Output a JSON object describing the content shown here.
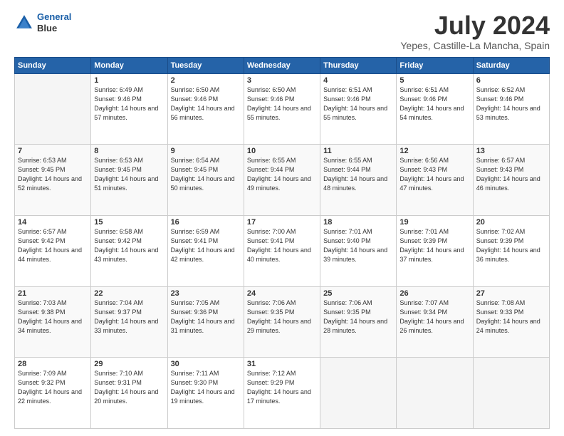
{
  "logo": {
    "line1": "General",
    "line2": "Blue"
  },
  "title": "July 2024",
  "subtitle": "Yepes, Castille-La Mancha, Spain",
  "days_header": [
    "Sunday",
    "Monday",
    "Tuesday",
    "Wednesday",
    "Thursday",
    "Friday",
    "Saturday"
  ],
  "weeks": [
    [
      {
        "day": "",
        "sunrise": "",
        "sunset": "",
        "daylight": ""
      },
      {
        "day": "1",
        "sunrise": "Sunrise: 6:49 AM",
        "sunset": "Sunset: 9:46 PM",
        "daylight": "Daylight: 14 hours and 57 minutes."
      },
      {
        "day": "2",
        "sunrise": "Sunrise: 6:50 AM",
        "sunset": "Sunset: 9:46 PM",
        "daylight": "Daylight: 14 hours and 56 minutes."
      },
      {
        "day": "3",
        "sunrise": "Sunrise: 6:50 AM",
        "sunset": "Sunset: 9:46 PM",
        "daylight": "Daylight: 14 hours and 55 minutes."
      },
      {
        "day": "4",
        "sunrise": "Sunrise: 6:51 AM",
        "sunset": "Sunset: 9:46 PM",
        "daylight": "Daylight: 14 hours and 55 minutes."
      },
      {
        "day": "5",
        "sunrise": "Sunrise: 6:51 AM",
        "sunset": "Sunset: 9:46 PM",
        "daylight": "Daylight: 14 hours and 54 minutes."
      },
      {
        "day": "6",
        "sunrise": "Sunrise: 6:52 AM",
        "sunset": "Sunset: 9:46 PM",
        "daylight": "Daylight: 14 hours and 53 minutes."
      }
    ],
    [
      {
        "day": "7",
        "sunrise": "Sunrise: 6:53 AM",
        "sunset": "Sunset: 9:45 PM",
        "daylight": "Daylight: 14 hours and 52 minutes."
      },
      {
        "day": "8",
        "sunrise": "Sunrise: 6:53 AM",
        "sunset": "Sunset: 9:45 PM",
        "daylight": "Daylight: 14 hours and 51 minutes."
      },
      {
        "day": "9",
        "sunrise": "Sunrise: 6:54 AM",
        "sunset": "Sunset: 9:45 PM",
        "daylight": "Daylight: 14 hours and 50 minutes."
      },
      {
        "day": "10",
        "sunrise": "Sunrise: 6:55 AM",
        "sunset": "Sunset: 9:44 PM",
        "daylight": "Daylight: 14 hours and 49 minutes."
      },
      {
        "day": "11",
        "sunrise": "Sunrise: 6:55 AM",
        "sunset": "Sunset: 9:44 PM",
        "daylight": "Daylight: 14 hours and 48 minutes."
      },
      {
        "day": "12",
        "sunrise": "Sunrise: 6:56 AM",
        "sunset": "Sunset: 9:43 PM",
        "daylight": "Daylight: 14 hours and 47 minutes."
      },
      {
        "day": "13",
        "sunrise": "Sunrise: 6:57 AM",
        "sunset": "Sunset: 9:43 PM",
        "daylight": "Daylight: 14 hours and 46 minutes."
      }
    ],
    [
      {
        "day": "14",
        "sunrise": "Sunrise: 6:57 AM",
        "sunset": "Sunset: 9:42 PM",
        "daylight": "Daylight: 14 hours and 44 minutes."
      },
      {
        "day": "15",
        "sunrise": "Sunrise: 6:58 AM",
        "sunset": "Sunset: 9:42 PM",
        "daylight": "Daylight: 14 hours and 43 minutes."
      },
      {
        "day": "16",
        "sunrise": "Sunrise: 6:59 AM",
        "sunset": "Sunset: 9:41 PM",
        "daylight": "Daylight: 14 hours and 42 minutes."
      },
      {
        "day": "17",
        "sunrise": "Sunrise: 7:00 AM",
        "sunset": "Sunset: 9:41 PM",
        "daylight": "Daylight: 14 hours and 40 minutes."
      },
      {
        "day": "18",
        "sunrise": "Sunrise: 7:01 AM",
        "sunset": "Sunset: 9:40 PM",
        "daylight": "Daylight: 14 hours and 39 minutes."
      },
      {
        "day": "19",
        "sunrise": "Sunrise: 7:01 AM",
        "sunset": "Sunset: 9:39 PM",
        "daylight": "Daylight: 14 hours and 37 minutes."
      },
      {
        "day": "20",
        "sunrise": "Sunrise: 7:02 AM",
        "sunset": "Sunset: 9:39 PM",
        "daylight": "Daylight: 14 hours and 36 minutes."
      }
    ],
    [
      {
        "day": "21",
        "sunrise": "Sunrise: 7:03 AM",
        "sunset": "Sunset: 9:38 PM",
        "daylight": "Daylight: 14 hours and 34 minutes."
      },
      {
        "day": "22",
        "sunrise": "Sunrise: 7:04 AM",
        "sunset": "Sunset: 9:37 PM",
        "daylight": "Daylight: 14 hours and 33 minutes."
      },
      {
        "day": "23",
        "sunrise": "Sunrise: 7:05 AM",
        "sunset": "Sunset: 9:36 PM",
        "daylight": "Daylight: 14 hours and 31 minutes."
      },
      {
        "day": "24",
        "sunrise": "Sunrise: 7:06 AM",
        "sunset": "Sunset: 9:35 PM",
        "daylight": "Daylight: 14 hours and 29 minutes."
      },
      {
        "day": "25",
        "sunrise": "Sunrise: 7:06 AM",
        "sunset": "Sunset: 9:35 PM",
        "daylight": "Daylight: 14 hours and 28 minutes."
      },
      {
        "day": "26",
        "sunrise": "Sunrise: 7:07 AM",
        "sunset": "Sunset: 9:34 PM",
        "daylight": "Daylight: 14 hours and 26 minutes."
      },
      {
        "day": "27",
        "sunrise": "Sunrise: 7:08 AM",
        "sunset": "Sunset: 9:33 PM",
        "daylight": "Daylight: 14 hours and 24 minutes."
      }
    ],
    [
      {
        "day": "28",
        "sunrise": "Sunrise: 7:09 AM",
        "sunset": "Sunset: 9:32 PM",
        "daylight": "Daylight: 14 hours and 22 minutes."
      },
      {
        "day": "29",
        "sunrise": "Sunrise: 7:10 AM",
        "sunset": "Sunset: 9:31 PM",
        "daylight": "Daylight: 14 hours and 20 minutes."
      },
      {
        "day": "30",
        "sunrise": "Sunrise: 7:11 AM",
        "sunset": "Sunset: 9:30 PM",
        "daylight": "Daylight: 14 hours and 19 minutes."
      },
      {
        "day": "31",
        "sunrise": "Sunrise: 7:12 AM",
        "sunset": "Sunset: 9:29 PM",
        "daylight": "Daylight: 14 hours and 17 minutes."
      },
      {
        "day": "",
        "sunrise": "",
        "sunset": "",
        "daylight": ""
      },
      {
        "day": "",
        "sunrise": "",
        "sunset": "",
        "daylight": ""
      },
      {
        "day": "",
        "sunrise": "",
        "sunset": "",
        "daylight": ""
      }
    ]
  ]
}
